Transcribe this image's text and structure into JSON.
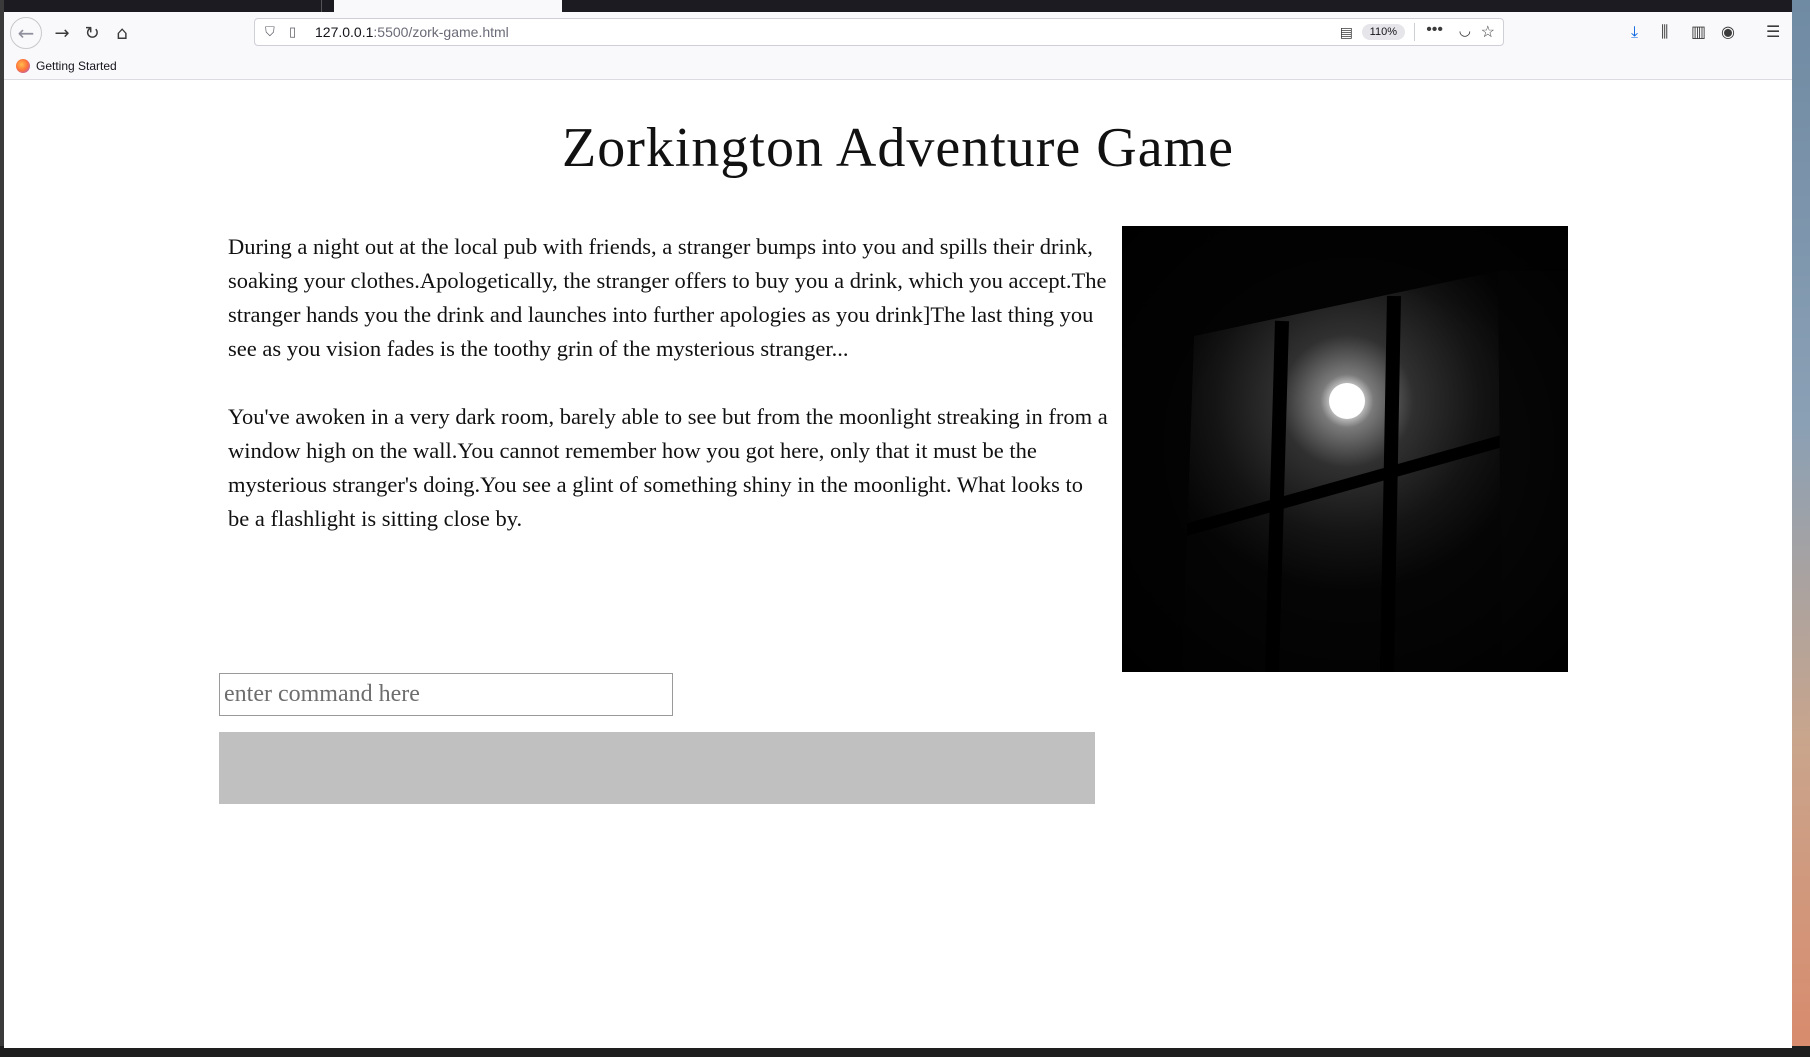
{
  "browser": {
    "url_host": "127.0.0.1",
    "url_path": ":5500/zork-game.html",
    "zoom": "110%",
    "bookmark_label": "Getting Started"
  },
  "game": {
    "title": "Zorkington Adventure Game",
    "intro_text": "During a night out at the local pub with friends, a stranger bumps into you and spills their drink, soaking your clothes.Apologetically, the stranger offers to buy you a drink, which you accept.The stranger hands you the drink and launches into further apologies as you drink]The last thing you see as you vision fades is the toothy grin of the mysterious stranger...",
    "room_text": "You've awoken in a very dark room, barely able to see but from the moonlight streaking in from a window high on the wall.You cannot remember how you got here, only that it must be the mysterious stranger's doing.You see a glint of something shiny in the moonlight. What looks to be a flashlight is sitting close by.",
    "command_placeholder": "enter command here",
    "command_value": "",
    "output_text": ""
  },
  "icons": {
    "back": "arrow-left-icon",
    "forward": "arrow-right-icon",
    "reload": "reload-icon",
    "home": "home-icon",
    "shield": "shield-icon",
    "page": "page-icon",
    "reader": "reader-view-icon",
    "more": "more-icon",
    "pocket": "pocket-icon",
    "star": "bookmark-star-icon",
    "download": "download-icon",
    "library": "library-icon",
    "sidebar": "sidebar-icon",
    "account": "account-icon",
    "menu": "hamburger-menu-icon"
  },
  "colors": {
    "output_box": "#c0c0c0",
    "download_accent": "#0060df"
  }
}
